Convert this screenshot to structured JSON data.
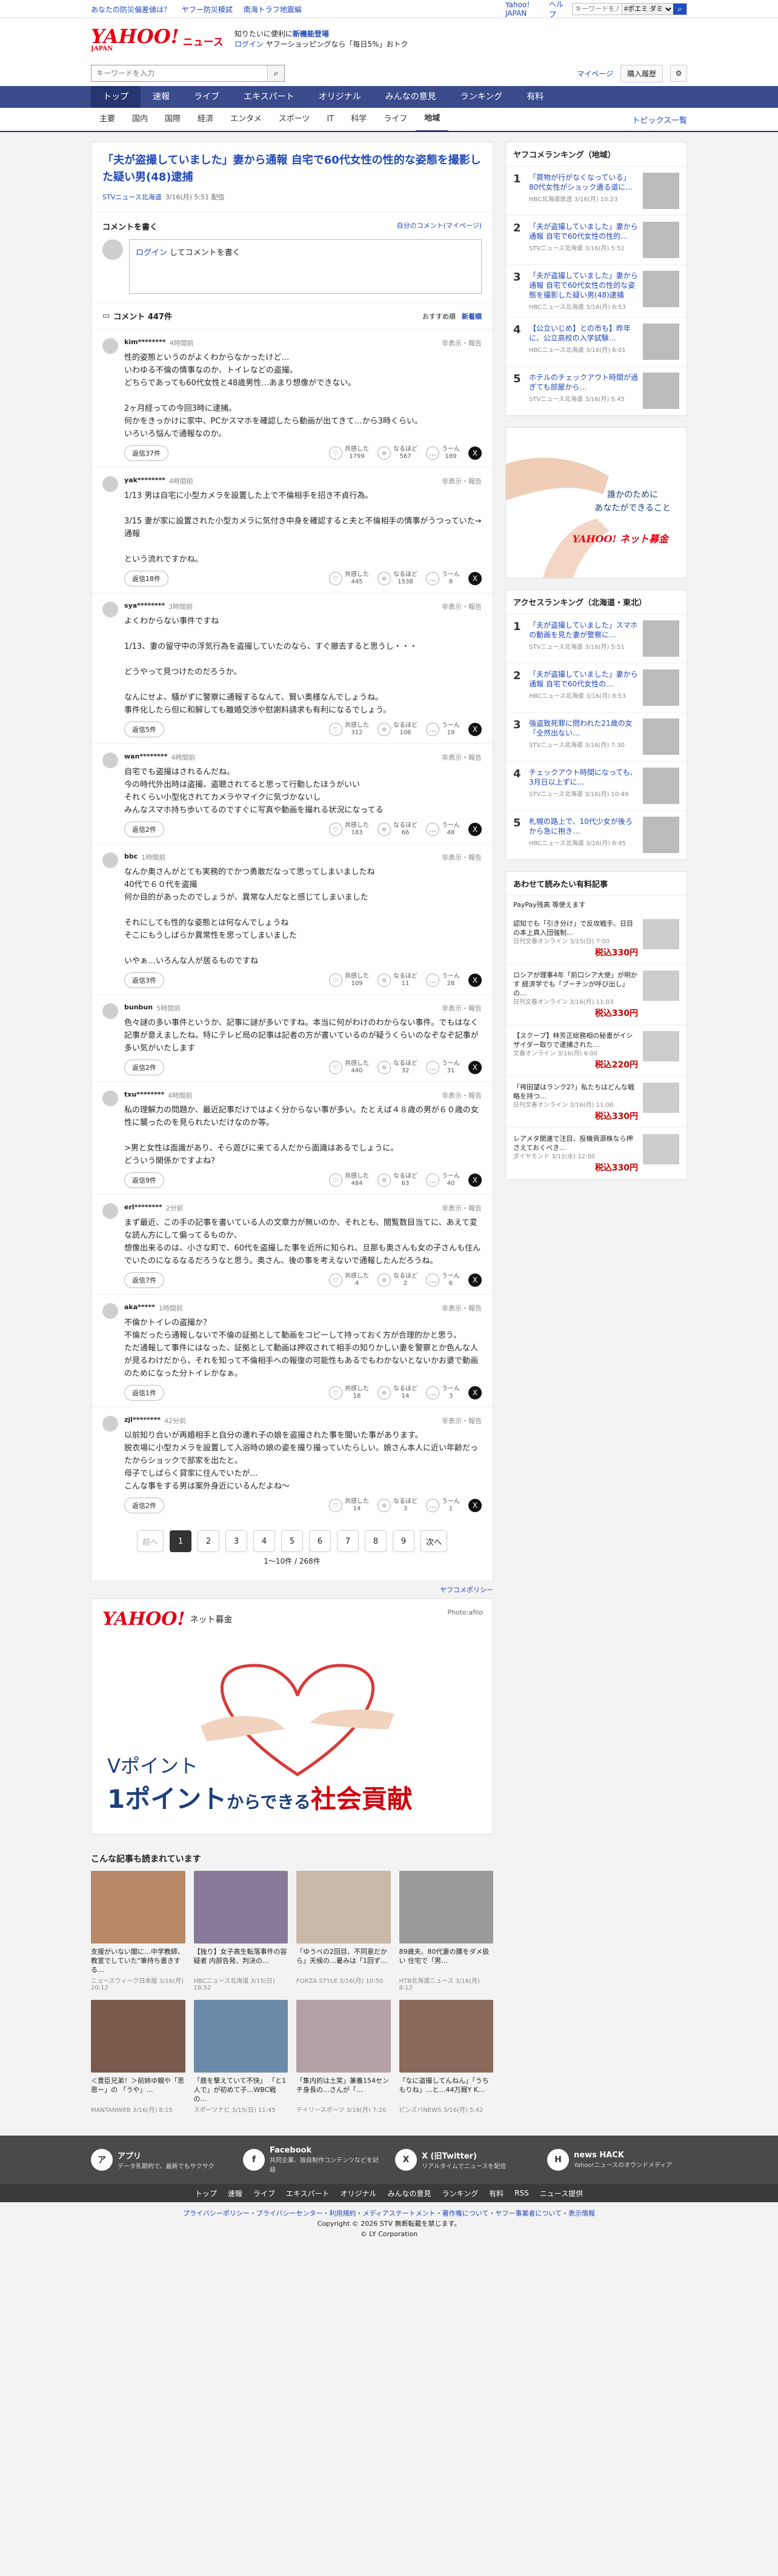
{
  "topbar": {
    "links": [
      "あなたの防災偏差値は？",
      "ヤフー防災模試",
      "南海トラフ地震編"
    ],
    "right": [
      "Yahoo! JAPAN",
      "ヘルプ"
    ],
    "search_placeholder": "ウェブ検索",
    "scope": "#ポエミ ダミ"
  },
  "header": {
    "logo": "YAHOO!",
    "logo_sub": "JAPAN",
    "service": "ニュース",
    "promo1": "知りたいに便利に",
    "promo1b": "新機能登場",
    "promo2a": "ログイン",
    "promo2": "ヤフーショッピングなら「毎日5%」おトク"
  },
  "search": {
    "placeholder": "キーワードを入力",
    "mypage": "マイページ",
    "buy": "購入履歴"
  },
  "gnav": [
    "トップ",
    "速報",
    "ライブ",
    "エキスパート",
    "オリジナル",
    "みんなの意見",
    "ランキング",
    "有料"
  ],
  "subnav": [
    "主要",
    "国内",
    "国際",
    "経済",
    "エンタメ",
    "スポーツ",
    "IT",
    "科学",
    "ライフ",
    "地域"
  ],
  "subnav_active": "地域",
  "topics_link": "トピックス一覧",
  "article": {
    "title": "「夫が盗撮していました」妻から通報 自宅で60代女性の性的な姿態を撮影した疑い男(48)逮捕",
    "source": "STVニュース北海道",
    "date": "3/16(月) 5:51",
    "badge": "配信"
  },
  "comment_post": {
    "heading": "コメントを書く",
    "self_link": "自分のコメント(マイページ)",
    "login": "ログイン",
    "placeholder": "してコメントを書く"
  },
  "comment_list": {
    "title": "コメント 447件",
    "sort_rec": "おすすめ順",
    "sort_new": "新着順"
  },
  "labels": {
    "reply": "返信",
    "report": "非表示・報告",
    "react1": "共感した",
    "react2": "なるほど",
    "react3": "うーん"
  },
  "comments": [
    {
      "user": "kim********",
      "time": "4時間前",
      "text": "性的姿態というのがよくわからなかったけど…\nいわゆる不倫の情事なのか、トイレなどの盗撮。\nどちらであっても60代女性と48歳男性…あまり想像ができない。\n\n2ヶ月経っての今回3時に逮捕。\n何かをきっかけに家中、PCかスマホを確認したら動画が出てきて…から3時くらい。\nいろいろ悩んで通報なのか。",
      "replies": "返信37件",
      "a": "1799",
      "b": "567",
      "c": "189"
    },
    {
      "user": "yak********",
      "time": "4時間前",
      "text": "1/13 男は自宅に小型カメラを設置した上で不倫相手を招き不貞行為。\n\n3/15 妻が家に設置された小型カメラに気付き中身を確認すると夫と不倫相手の情事がうつっていた→通報\n\nという流れですかね。",
      "replies": "返信18件",
      "a": "445",
      "b": "1538",
      "c": "8"
    },
    {
      "user": "sya********",
      "time": "3時間前",
      "text": "よくわからない事件ですね\n\n1/13、妻の留守中の浮気行為を盗撮していたのなら、すぐ撤去すると思うし・・・\n\nどうやって見つけたのだろうか。\n\nなんにせよ、騒がずに警察に通報するなんて、賢い奥様なんでしょうね。\n事件化したら但に和解しても離婚交渉や慰謝料請求も有利になるでしょう。",
      "replies": "返信5件",
      "a": "312",
      "b": "106",
      "c": "19"
    },
    {
      "user": "wan********",
      "time": "4時間前",
      "text": "自宅でも盗撮はされるんだね。\n今の時代外出時は盗撮、盗聴されてると思って行動したほうがいい\nそれくらい小型化されてカメラやマイクに気づかないし\nみんなスマホ持ち歩いてるのですぐに写真や動画を撮れる状況になってる",
      "replies": "返信2件",
      "a": "183",
      "b": "66",
      "c": "48"
    },
    {
      "user": "bbc",
      "time": "1時間前",
      "text": "なんか奥さんがとても実務的でかつ勇敢だなって思ってしまいましたね\n40代で６０代を盗撮\n何か目的があったのでしょうが、異常な人だなと感じてしまいました\n\nそれにしても性的な姿態とは何なんでしょうね\nそこにもうしばらか異常性を思ってしまいました\n\nいやぁ…いろんな人が居るものですね",
      "replies": "返信3件",
      "a": "109",
      "b": "11",
      "c": "28"
    },
    {
      "user": "bunbun",
      "time": "5時間前",
      "text": "色々謎の多い事件というか、記事に謎が多いですね。本当に何がわけのわからない事件。でもはなく記事が意えましたね。特にテレビ局の記事は記者の方が書いているのが疑うくらいのなぞなぞ記事が多い気がいたします",
      "replies": "返信2件",
      "a": "440",
      "b": "32",
      "c": "31"
    },
    {
      "user": "txu********",
      "time": "4時間前",
      "text": "私の理解力の問題か、最近記事だけではよく分からない事が多い。たとえば４８歳の男が６０歳の女性に襲ったのを見られたいだけなのか等。\n\n>男と女性は面識があり、そら遊びに来てる人だから面識はあるでしょうに。\nどういう関係かですよね？",
      "replies": "返信9件",
      "a": "484",
      "b": "63",
      "c": "40"
    },
    {
      "user": "erl********",
      "time": "2分前",
      "text": "まず最近、この手の記事を書いている人の文章力が無いのか、それとも、閲覧数目当てに、あえて変な読ん方にして偏ってるものか、\n想像出来るのは、小さな町で、60代を盗撮した事を近所に知られ、旦那も奥さんも女の子さんも住んでいたのになるなるだろうなと思う。奥さん、後の事を考えないで通報したんだろうね。",
      "replies": "返信7件",
      "a": "4",
      "b": "2",
      "c": "6"
    },
    {
      "user": "aka*****",
      "time": "1時間前",
      "text": "不倫かトイレの盗撮か？\n不倫だったら通報しないで不倫の証拠として動画をコピーして持っておく方が合理的かと思う。\nただ通報して事件にはなった、証拠として動画は押収されて相手の知りかしい妻を警察とか色んな人が見るわけだから、それを知って不倫相手への報復の可能性もあるでもわかないとないかお婆で動画のためになった分トイレかなぁ。",
      "replies": "返信1件",
      "a": "18",
      "b": "14",
      "c": "3"
    },
    {
      "user": "zjl********",
      "time": "42分前",
      "text": "以前知り合いが再婚相手と自分の連れ子の娘を盗撮された事を聞いた事があります。\n脱衣場に小型カメラを設置して入浴時の娘の姿を撮り撮っていたらしい。娘さん本人に近い年齢だったからショックで部家を出たと。\n母子でしばらく貸家に住んでいたが…\nこんな事をする男は案外身近にいるんだよね〜",
      "replies": "返信2件",
      "a": "14",
      "b": "3",
      "c": "1"
    }
  ],
  "pager": {
    "prev": "前へ",
    "pages": [
      "1",
      "2",
      "3",
      "4",
      "5",
      "6",
      "7",
      "8",
      "9"
    ],
    "next": "次へ",
    "count": "1〜10件 / 268件"
  },
  "policy": "ヤフコメポリシー",
  "big_ad": {
    "logo": "YAHOO!",
    "sub": "ネット募金",
    "photo": "Photo:afilo",
    "line1": "Vポイント",
    "line2a": "1ポイント",
    "line2b": "からできる",
    "line2c": "社会貢献"
  },
  "related": {
    "title": "こんな記事も読まれています",
    "items": [
      {
        "t": "支援がいない闇に…中学教師、教室でしていた\"筆持ち書きする…",
        "s": "ニュースウィーク日本版 3/16(月) 20:12"
      },
      {
        "t": "【独り】女子高生転落事件の容疑者 内部告発、判決の…",
        "s": "HBCニュース北海道 3/15(日) 18:52"
      },
      {
        "t": "「ゆうべの2回目、不同意だから」天候の…暑みは「1回ず…",
        "s": "FORZA STYLE 3/16(月) 10:50"
      },
      {
        "t": "89歳夫、80代妻の腰をダメ扱い 住宅で「男…",
        "s": "HTB北海道ニュース 3/16(月) 8:12"
      },
      {
        "t": "＜豊臣兄弟！＞前姉ゆ親や「思恩ー」の 「うや」…",
        "s": "MANTANWEB 3/16(月) 8:15"
      },
      {
        "t": "「鹿を撃えていて不快」 「と1人で」が初めて子…WBC戦の…",
        "s": "スポーツナビ 3/15(日) 11:45"
      },
      {
        "t": "「集内的は土笑」兼養154センチ身長の…さんが「…",
        "s": "デイリースポーツ 3/16(月) 7:20"
      },
      {
        "t": "「なに盗撮してんねん」「うちもりね」…と…44万厩Y K…",
        "s": "ピンズバNEWS 3/16(月) 5:42"
      }
    ]
  },
  "ranking_local": {
    "title": "ヤフコメランキング（地域）",
    "items": [
      {
        "t": "「買物が行がなくなっている」80代女性がショック遺る道に…",
        "s": "HBC北海道放送 3/16(月) 10:23"
      },
      {
        "t": "「夫が盗撮していました」妻から通報 自宅で60代女性の性的…",
        "s": "STVニュース北海道 3/16(月) 5:51"
      },
      {
        "t": "「夫が盗撮していました」妻から通報 自宅で60代女性の性的な姿態を撮影した疑い男(48)逮捕",
        "s": "HBCニュース北海道 3/16(月) 8:53"
      },
      {
        "t": "【公立いじめ】との市も】昨年に、公立高校の入学試験…",
        "s": "HBCニュース北海道 3/16(月) 6:01"
      },
      {
        "t": "ホテルのチェックアウト時間が過ぎても部屋から…",
        "s": "STVニュース北海道 3/16(月) 5:45"
      }
    ]
  },
  "side_ad": {
    "text1": "誰かのために",
    "text2": "あなたができること",
    "logo": "YAHOO! ネット募金"
  },
  "ranking_access": {
    "title": "アクセスランキング（北海道・東北）",
    "items": [
      {
        "t": "「夫が盗撮していました」スマホの動画を見た妻が警察に…",
        "s": "STVニュース北海道 3/16(月) 5:51"
      },
      {
        "t": "「夫が盗撮していました」妻から通報 自宅で60代女性の…",
        "s": "HBCニュース北海道 3/16(月) 8:53"
      },
      {
        "t": "強盗致死罪に問われた21歳の女「全然出ない…",
        "s": "STVニュース北海道 3/16(月) 7:30"
      },
      {
        "t": "チェックアウト時間になっても、3月日以上ずに…",
        "s": "STVニュース北海道 3/16(月) 10:49"
      },
      {
        "t": "札幌の路上で、10代少女が後ろから急に抱き…",
        "s": "HBCニュース北海道 3/16(月) 8:45"
      }
    ]
  },
  "shopping": {
    "title": "あわせて読みたい有料記事",
    "sponsor": "PayPay残高 等使えます",
    "items": [
      {
        "t": "認知でも「引き分け」で反攻戦手、日目の本上真入団強制…",
        "s": "日刊文春オンライン 3/15(日) 7:00",
        "p": "税込330円"
      },
      {
        "t": "ロシアが理事4年「前口シア大使」が明かす 経済学でも「プーチンが呼び出し」の…",
        "s": "日刊文春オンライン 3/16(月) 11:03",
        "p": "税込330円"
      },
      {
        "t": "【スクープ】林芳正総務相の秘書がイシザイダー取りで逮捕された…",
        "s": "文春オンライン 3/16(月) 6:00",
        "p": "税込220円"
      },
      {
        "t": "「袴田望はランク2?」私たちはどんな戦略を持つ…",
        "s": "日刊文春オンライン 3/16(月) 11:00",
        "p": "税込330円"
      },
      {
        "t": "レアメタ関連で注目、投機資源株なら押さえておくべき…",
        "s": "ダイヤモンド 3/11(水) 12:00",
        "p": "税込330円"
      }
    ]
  },
  "footer": {
    "items": [
      {
        "icon": "ア",
        "title": "アプリ",
        "desc": "データ乳節約で、最新でもサクサク"
      },
      {
        "icon": "f",
        "title": "Facebook",
        "desc": "共同企業、独自制作コンテンツなどを記録"
      },
      {
        "icon": "X",
        "title": "X (旧Twitter)",
        "desc": "リアルタイムでニュースを配信"
      },
      {
        "icon": "H",
        "title": "news HACK",
        "desc": "Yahoo!ニュースのオウンドメディア"
      }
    ],
    "nav": [
      "トップ",
      "速報",
      "ライブ",
      "エキスパート",
      "オリジナル",
      "みんなの意見",
      "ランキング",
      "有料",
      "RSS",
      "ニュース提供"
    ],
    "legal1": "プライバシーポリシー・プライバシーセンター・利用規約・メディアステートメント・著作権について・ヤフー事業者について・表示情報",
    "legal2": "Copyright © 2026 STV 無断転載を禁じます。",
    "legal3": "© LY Corporation"
  },
  "colors": {
    "nav": "#3a4b8c",
    "accent": "#1f47b8",
    "brand": "#e60012"
  }
}
